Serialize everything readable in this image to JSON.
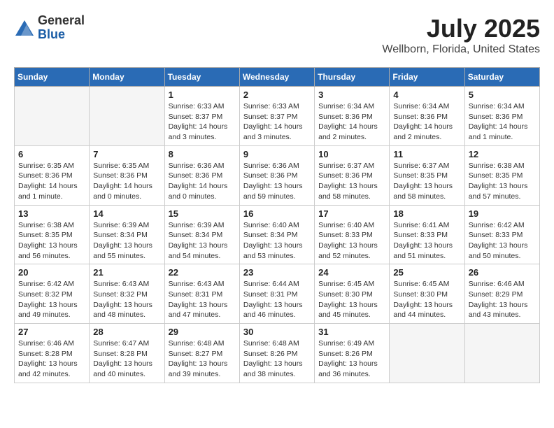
{
  "header": {
    "logo_general": "General",
    "logo_blue": "Blue",
    "month": "July 2025",
    "location": "Wellborn, Florida, United States"
  },
  "weekdays": [
    "Sunday",
    "Monday",
    "Tuesday",
    "Wednesday",
    "Thursday",
    "Friday",
    "Saturday"
  ],
  "weeks": [
    [
      {
        "day": "",
        "info": ""
      },
      {
        "day": "",
        "info": ""
      },
      {
        "day": "1",
        "info": "Sunrise: 6:33 AM\nSunset: 8:37 PM\nDaylight: 14 hours and 3 minutes."
      },
      {
        "day": "2",
        "info": "Sunrise: 6:33 AM\nSunset: 8:37 PM\nDaylight: 14 hours and 3 minutes."
      },
      {
        "day": "3",
        "info": "Sunrise: 6:34 AM\nSunset: 8:36 PM\nDaylight: 14 hours and 2 minutes."
      },
      {
        "day": "4",
        "info": "Sunrise: 6:34 AM\nSunset: 8:36 PM\nDaylight: 14 hours and 2 minutes."
      },
      {
        "day": "5",
        "info": "Sunrise: 6:34 AM\nSunset: 8:36 PM\nDaylight: 14 hours and 1 minute."
      }
    ],
    [
      {
        "day": "6",
        "info": "Sunrise: 6:35 AM\nSunset: 8:36 PM\nDaylight: 14 hours and 1 minute."
      },
      {
        "day": "7",
        "info": "Sunrise: 6:35 AM\nSunset: 8:36 PM\nDaylight: 14 hours and 0 minutes."
      },
      {
        "day": "8",
        "info": "Sunrise: 6:36 AM\nSunset: 8:36 PM\nDaylight: 14 hours and 0 minutes."
      },
      {
        "day": "9",
        "info": "Sunrise: 6:36 AM\nSunset: 8:36 PM\nDaylight: 13 hours and 59 minutes."
      },
      {
        "day": "10",
        "info": "Sunrise: 6:37 AM\nSunset: 8:36 PM\nDaylight: 13 hours and 58 minutes."
      },
      {
        "day": "11",
        "info": "Sunrise: 6:37 AM\nSunset: 8:35 PM\nDaylight: 13 hours and 58 minutes."
      },
      {
        "day": "12",
        "info": "Sunrise: 6:38 AM\nSunset: 8:35 PM\nDaylight: 13 hours and 57 minutes."
      }
    ],
    [
      {
        "day": "13",
        "info": "Sunrise: 6:38 AM\nSunset: 8:35 PM\nDaylight: 13 hours and 56 minutes."
      },
      {
        "day": "14",
        "info": "Sunrise: 6:39 AM\nSunset: 8:34 PM\nDaylight: 13 hours and 55 minutes."
      },
      {
        "day": "15",
        "info": "Sunrise: 6:39 AM\nSunset: 8:34 PM\nDaylight: 13 hours and 54 minutes."
      },
      {
        "day": "16",
        "info": "Sunrise: 6:40 AM\nSunset: 8:34 PM\nDaylight: 13 hours and 53 minutes."
      },
      {
        "day": "17",
        "info": "Sunrise: 6:40 AM\nSunset: 8:33 PM\nDaylight: 13 hours and 52 minutes."
      },
      {
        "day": "18",
        "info": "Sunrise: 6:41 AM\nSunset: 8:33 PM\nDaylight: 13 hours and 51 minutes."
      },
      {
        "day": "19",
        "info": "Sunrise: 6:42 AM\nSunset: 8:33 PM\nDaylight: 13 hours and 50 minutes."
      }
    ],
    [
      {
        "day": "20",
        "info": "Sunrise: 6:42 AM\nSunset: 8:32 PM\nDaylight: 13 hours and 49 minutes."
      },
      {
        "day": "21",
        "info": "Sunrise: 6:43 AM\nSunset: 8:32 PM\nDaylight: 13 hours and 48 minutes."
      },
      {
        "day": "22",
        "info": "Sunrise: 6:43 AM\nSunset: 8:31 PM\nDaylight: 13 hours and 47 minutes."
      },
      {
        "day": "23",
        "info": "Sunrise: 6:44 AM\nSunset: 8:31 PM\nDaylight: 13 hours and 46 minutes."
      },
      {
        "day": "24",
        "info": "Sunrise: 6:45 AM\nSunset: 8:30 PM\nDaylight: 13 hours and 45 minutes."
      },
      {
        "day": "25",
        "info": "Sunrise: 6:45 AM\nSunset: 8:30 PM\nDaylight: 13 hours and 44 minutes."
      },
      {
        "day": "26",
        "info": "Sunrise: 6:46 AM\nSunset: 8:29 PM\nDaylight: 13 hours and 43 minutes."
      }
    ],
    [
      {
        "day": "27",
        "info": "Sunrise: 6:46 AM\nSunset: 8:28 PM\nDaylight: 13 hours and 42 minutes."
      },
      {
        "day": "28",
        "info": "Sunrise: 6:47 AM\nSunset: 8:28 PM\nDaylight: 13 hours and 40 minutes."
      },
      {
        "day": "29",
        "info": "Sunrise: 6:48 AM\nSunset: 8:27 PM\nDaylight: 13 hours and 39 minutes."
      },
      {
        "day": "30",
        "info": "Sunrise: 6:48 AM\nSunset: 8:26 PM\nDaylight: 13 hours and 38 minutes."
      },
      {
        "day": "31",
        "info": "Sunrise: 6:49 AM\nSunset: 8:26 PM\nDaylight: 13 hours and 36 minutes."
      },
      {
        "day": "",
        "info": ""
      },
      {
        "day": "",
        "info": ""
      }
    ]
  ]
}
